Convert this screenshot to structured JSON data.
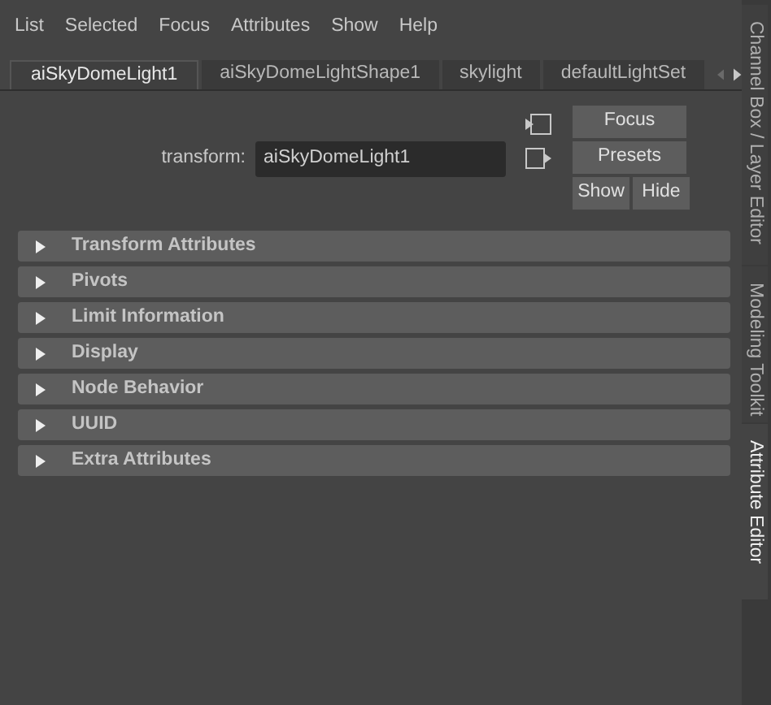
{
  "menu_bar": [
    "List",
    "Selected",
    "Focus",
    "Attributes",
    "Show",
    "Help"
  ],
  "tabs": [
    {
      "label": "aiSkyDomeLight1",
      "selected": true
    },
    {
      "label": "aiSkyDomeLightShape1",
      "selected": false
    },
    {
      "label": "skylight",
      "selected": false
    },
    {
      "label": "defaultLightSet",
      "selected": false
    }
  ],
  "node": {
    "label": "transform:",
    "value": "aiSkyDomeLight1"
  },
  "buttons": {
    "focus": "Focus",
    "presets": "Presets",
    "show": "Show",
    "hide": "Hide"
  },
  "sections": [
    {
      "title": "Transform Attributes",
      "expanded": false
    },
    {
      "title": "Pivots",
      "expanded": false
    },
    {
      "title": "Limit Information",
      "expanded": false
    },
    {
      "title": "Display",
      "expanded": false
    },
    {
      "title": "Node Behavior",
      "expanded": false
    },
    {
      "title": "UUID",
      "expanded": false
    },
    {
      "title": "Extra Attributes",
      "expanded": false
    }
  ],
  "side_tabs": [
    {
      "label": "Channel Box / Layer Editor",
      "selected": false
    },
    {
      "label": "Modeling Toolkit",
      "selected": false
    },
    {
      "label": "Attribute Editor",
      "selected": true
    }
  ]
}
